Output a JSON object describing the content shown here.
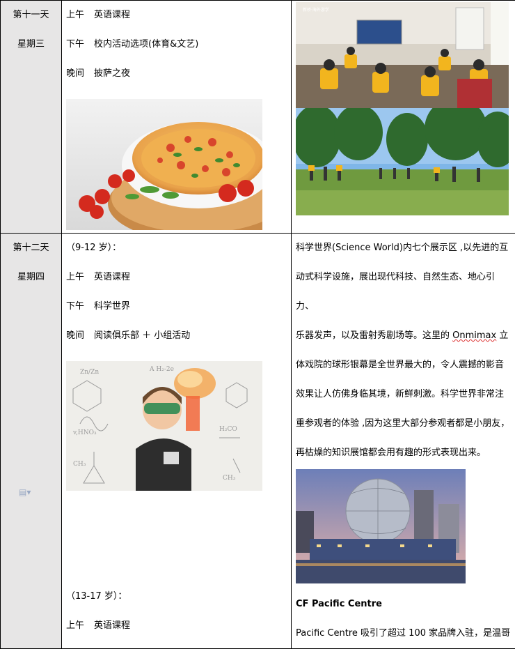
{
  "row11": {
    "day": "第十一天",
    "weekday": "星期三",
    "items": [
      {
        "time": "上午",
        "activity": "英语课程"
      },
      {
        "time": "下午",
        "activity": "校内活动选项(体育&文艺)"
      },
      {
        "time": "晚间",
        "activity": "披萨之夜"
      }
    ],
    "photo_logo": "新桥·海外游学"
  },
  "row12": {
    "day": "第十二天",
    "weekday": "星期四",
    "age_group_a": "（9-12 岁）：",
    "items_a": [
      {
        "time": "上午",
        "activity": "英语课程"
      },
      {
        "time": "下午",
        "activity": "科学世界"
      },
      {
        "time": "晚间",
        "activity": "阅读俱乐部 ＋ 小组活动"
      }
    ],
    "age_group_b": "（13-17 岁）：",
    "items_b": [
      {
        "time": "上午",
        "activity": "英语课程"
      }
    ],
    "science_lines": [
      "科学世界(Science World)内七个展示区 ,以先进的互",
      "动式科学设施，展出现代科技、自然生态、地心引力、",
      "乐器发声，以及雷射秀剧场等。这里的 Onmimax 立",
      "体戏院的球形银幕是全世界最大的，令人震撼的影音",
      "效果让人仿佛身临其境，新鲜刺激。科学世界非常注",
      "重参观者的体验 ,因为这里大部分参观者都是小朋友，",
      "再枯燥的知识展馆都会用有趣的形式表现出来。"
    ],
    "pacific_title": "CF Pacific Centre",
    "pacific_text": "Pacific Centre 吸引了超过 100 家品牌入驻，是温哥"
  }
}
